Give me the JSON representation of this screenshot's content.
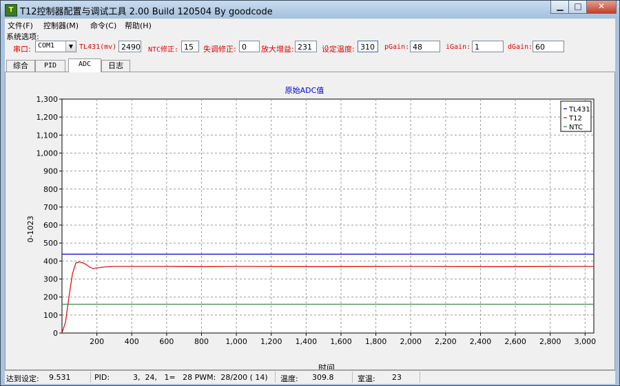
{
  "window": {
    "title": "T12控制器配置与调试工具 2.00 Build 120504 By goodcode",
    "icon": "app-icon"
  },
  "menu": [
    {
      "label": "文件(F)"
    },
    {
      "label": "控制器(M)"
    },
    {
      "label": "命令(C)"
    },
    {
      "label": "帮助(H)"
    }
  ],
  "settings": {
    "group_label": "系统选项:",
    "port_label": "串口:",
    "port_value": "COM1",
    "tl431_label": "TL431(mv)",
    "tl431_value": "2490",
    "ntc_label": "NTC修正:",
    "ntc_value": "15",
    "offset_label": "失调修正:",
    "offset_value": "0",
    "gain_label": "放大增益:",
    "gain_value": "231",
    "settemp_label": "设定温度:",
    "settemp_value": "310",
    "pgain_label": "pGain:",
    "pgain_value": "48",
    "igain_label": "iGain:",
    "igain_value": "1",
    "dgain_label": "dGain:",
    "dgain_value": "60"
  },
  "tabs": [
    {
      "label": "综合"
    },
    {
      "label": "PID"
    },
    {
      "label": "ADC",
      "active": true
    },
    {
      "label": "日志"
    }
  ],
  "status": {
    "reached_label": "达到设定:",
    "reached_value": "9.531",
    "pid_label": "PID:",
    "pid_value": "3,  24,   1=   28 PWM:  28/200 ( 14)",
    "temp_label": "温度:",
    "temp_value": "309.8",
    "room_label": "室温:",
    "room_value": "23"
  },
  "chart_data": {
    "type": "line",
    "title": "原始ADC值",
    "xlabel": "时间",
    "ylabel": "0-1023",
    "xlim": [
      0,
      3050
    ],
    "ylim": [
      0,
      1300
    ],
    "x_ticks": [
      200,
      400,
      600,
      800,
      1000,
      1200,
      1400,
      1600,
      1800,
      2000,
      2200,
      2400,
      2600,
      2800,
      3000
    ],
    "x_tick_labels": [
      "200",
      "400",
      "600",
      "800",
      "1,000",
      "1,200",
      "1,400",
      "1,600",
      "1,800",
      "2,000",
      "2,200",
      "2,400",
      "2,600",
      "2,800",
      "3,000"
    ],
    "y_ticks": [
      0,
      100,
      200,
      300,
      400,
      500,
      600,
      700,
      800,
      900,
      1000,
      1100,
      1200,
      1300
    ],
    "y_tick_labels": [
      "0",
      "100",
      "200",
      "300",
      "400",
      "500",
      "600",
      "700",
      "800",
      "900",
      "1,000",
      "1,100",
      "1,200",
      "1,300"
    ],
    "grid": true,
    "legend_position": "top-right",
    "series": [
      {
        "name": "TL431",
        "color": "#0000cc",
        "x": [
          0,
          3050
        ],
        "y": [
          438,
          438
        ]
      },
      {
        "name": "T12",
        "color": "#dd0000",
        "x": [
          0,
          20,
          40,
          60,
          80,
          100,
          120,
          140,
          160,
          180,
          200,
          250,
          300,
          400,
          600,
          800,
          1000,
          1500,
          2000,
          2500,
          3000,
          3050
        ],
        "y": [
          0,
          60,
          200,
          330,
          390,
          395,
          390,
          380,
          365,
          358,
          362,
          368,
          370,
          370,
          370,
          369,
          370,
          369,
          370,
          369,
          370,
          370
        ]
      },
      {
        "name": "NTC",
        "color": "#2a7a3a",
        "x": [
          0,
          3050
        ],
        "y": [
          160,
          160
        ]
      }
    ]
  }
}
